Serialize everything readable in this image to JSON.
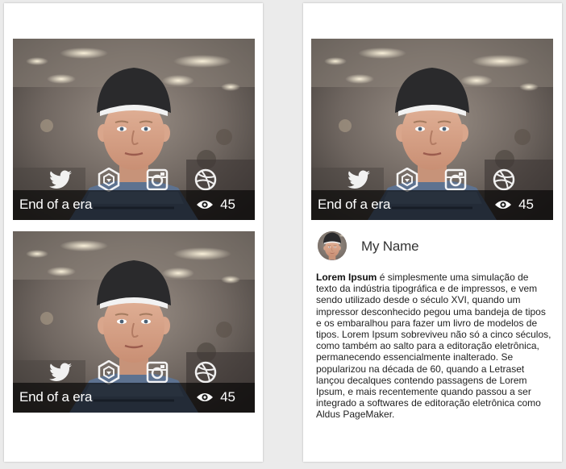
{
  "cards": [
    {
      "title": "End of a era",
      "views": "45",
      "icons": [
        "twitter-icon",
        "hexagon-badge-icon",
        "instagram-icon",
        "dribbble-icon"
      ]
    },
    {
      "title": "End of a era",
      "views": "45",
      "icons": [
        "twitter-icon",
        "hexagon-badge-icon",
        "instagram-icon",
        "dribbble-icon"
      ]
    },
    {
      "title": "End of a era",
      "views": "45",
      "icons": [
        "twitter-icon",
        "hexagon-badge-icon",
        "instagram-icon",
        "dribbble-icon"
      ]
    }
  ],
  "profile": {
    "name": "My Name",
    "bio_lead": "Lorem Ipsum",
    "bio_rest": " é simplesmente uma simulação de texto da indústria tipográfica e de impressos, e vem sendo utilizado desde o século XVI, quando um impressor desconhecido pegou uma bandeja de tipos e os embaralhou para fazer um livro de modelos de tipos. Lorem Ipsum sobreviveu não só a cinco séculos, como também ao salto para a editoração eletrônica, permanecendo essencialmente inalterado. Se popularizou na década de 60, quando a Letraset lançou decalques contendo passagens de Lorem Ipsum, e mais recentemente quando passou a ser integrado a softwares de editoração eletrônica como Aldus PageMaker."
  },
  "colors": {
    "page_background": "#ebebeb",
    "panel_background": "#ffffff",
    "overlay": "#000000",
    "overlay_text": "#ffffff"
  }
}
